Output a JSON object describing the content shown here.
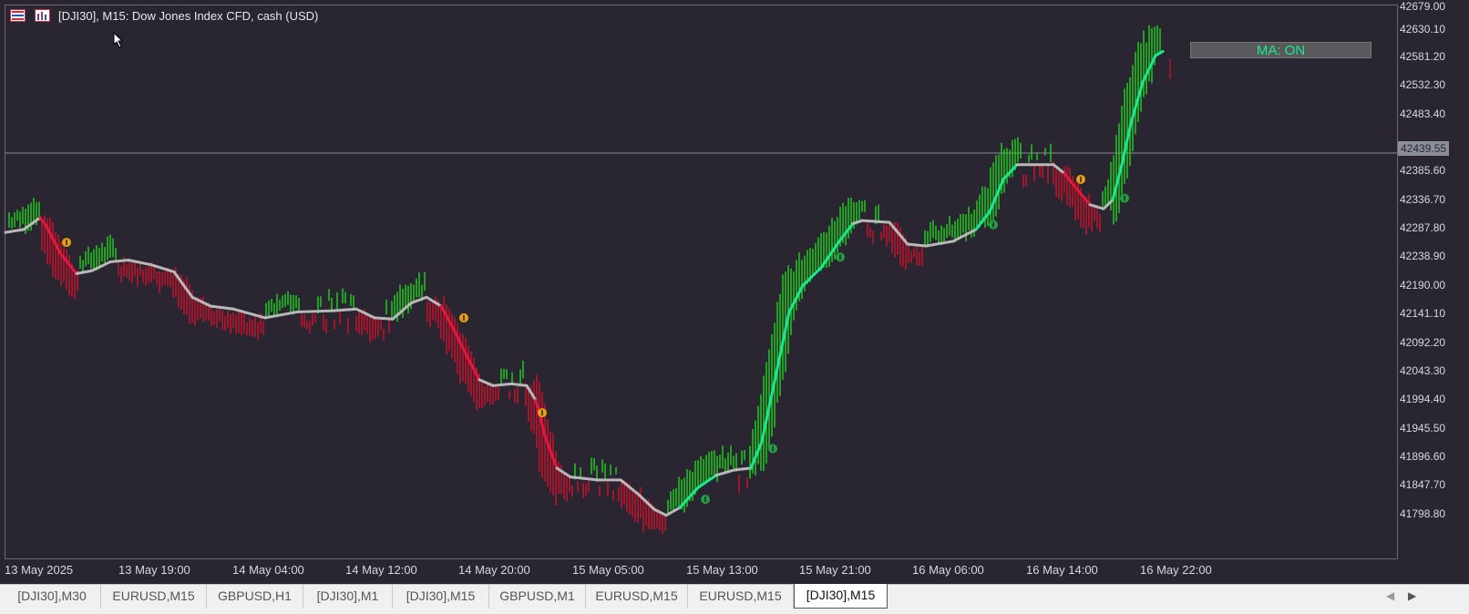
{
  "window": {
    "title": "[DJI30], M15:  Dow Jones Index CFD, cash (USD)",
    "current_price": "42439.55",
    "ma_button_label": "MA: ON"
  },
  "price_axis": {
    "labels": [
      "42679.00",
      "42630.10",
      "42581.20",
      "42532.30",
      "42483.40",
      "42385.60",
      "42336.70",
      "42287.80",
      "42238.90",
      "42190.00",
      "42141.10",
      "42092.20",
      "42043.30",
      "41994.40",
      "41945.50",
      "41896.60",
      "41847.70",
      "41798.80"
    ]
  },
  "time_axis": {
    "labels": [
      "13 May 2025",
      "13 May 19:00",
      "14 May 04:00",
      "14 May 12:00",
      "14 May 20:00",
      "15 May 05:00",
      "15 May 13:00",
      "15 May 21:00",
      "16 May 06:00",
      "16 May 14:00",
      "16 May 22:00"
    ]
  },
  "tabs": [
    {
      "label": "[DJI30],M30",
      "active": false
    },
    {
      "label": "EURUSD,M15",
      "active": false
    },
    {
      "label": "GBPUSD,H1",
      "active": false
    },
    {
      "label": "[DJI30],M1",
      "active": false
    },
    {
      "label": "[DJI30],M15",
      "active": false
    },
    {
      "label": "GBPUSD,M1",
      "active": false
    },
    {
      "label": "EURUSD,M15",
      "active": false
    },
    {
      "label": "EURUSD,M15",
      "active": false
    },
    {
      "label": "[DJI30],M15",
      "active": true
    }
  ],
  "icons": {
    "title_icon_1": "bars-icon",
    "title_icon_2": "chart-window-icon",
    "scroll_left": "chevron-left-icon",
    "scroll_right": "chevron-right-icon",
    "cursor": "mouse-pointer-icon"
  },
  "chart_data": {
    "type": "line",
    "ylim": [
      41775,
      42690
    ],
    "xlim": [
      0,
      1485
    ],
    "colors": {
      "bull_bar": "#1ed41e",
      "bear_bar": "#d4102a",
      "ma_neutral": "#b8b8b8",
      "ma_up": "#19e88e",
      "ma_down": "#e4163c",
      "signal_up": "#20a040",
      "signal_down": "#e8a010",
      "current_price_line": "#8a8f9a"
    },
    "current_price": 42439.55,
    "ma_series": [
      {
        "x": 0,
        "y": 42305,
        "trend": "neutral"
      },
      {
        "x": 20,
        "y": 42310,
        "trend": "neutral"
      },
      {
        "x": 38,
        "y": 42330,
        "trend": "neutral"
      },
      {
        "x": 45,
        "y": 42315,
        "trend": "down"
      },
      {
        "x": 60,
        "y": 42270,
        "trend": "down"
      },
      {
        "x": 78,
        "y": 42235,
        "trend": "down"
      },
      {
        "x": 95,
        "y": 42240,
        "trend": "neutral"
      },
      {
        "x": 115,
        "y": 42255,
        "trend": "neutral"
      },
      {
        "x": 135,
        "y": 42258,
        "trend": "neutral"
      },
      {
        "x": 160,
        "y": 42250,
        "trend": "neutral"
      },
      {
        "x": 185,
        "y": 42238,
        "trend": "neutral"
      },
      {
        "x": 205,
        "y": 42195,
        "trend": "neutral"
      },
      {
        "x": 225,
        "y": 42180,
        "trend": "neutral"
      },
      {
        "x": 250,
        "y": 42175,
        "trend": "neutral"
      },
      {
        "x": 285,
        "y": 42160,
        "trend": "neutral"
      },
      {
        "x": 320,
        "y": 42170,
        "trend": "neutral"
      },
      {
        "x": 360,
        "y": 42172,
        "trend": "neutral"
      },
      {
        "x": 385,
        "y": 42175,
        "trend": "neutral"
      },
      {
        "x": 405,
        "y": 42160,
        "trend": "neutral"
      },
      {
        "x": 425,
        "y": 42158,
        "trend": "neutral"
      },
      {
        "x": 445,
        "y": 42185,
        "trend": "neutral"
      },
      {
        "x": 462,
        "y": 42195,
        "trend": "neutral"
      },
      {
        "x": 478,
        "y": 42180,
        "trend": "neutral"
      },
      {
        "x": 492,
        "y": 42140,
        "trend": "down"
      },
      {
        "x": 508,
        "y": 42090,
        "trend": "down"
      },
      {
        "x": 520,
        "y": 42055,
        "trend": "down"
      },
      {
        "x": 535,
        "y": 42045,
        "trend": "neutral"
      },
      {
        "x": 555,
        "y": 42048,
        "trend": "neutral"
      },
      {
        "x": 572,
        "y": 42045,
        "trend": "neutral"
      },
      {
        "x": 582,
        "y": 42020,
        "trend": "neutral"
      },
      {
        "x": 592,
        "y": 41960,
        "trend": "down"
      },
      {
        "x": 605,
        "y": 41905,
        "trend": "down"
      },
      {
        "x": 620,
        "y": 41890,
        "trend": "neutral"
      },
      {
        "x": 650,
        "y": 41885,
        "trend": "neutral"
      },
      {
        "x": 675,
        "y": 41885,
        "trend": "neutral"
      },
      {
        "x": 695,
        "y": 41860,
        "trend": "neutral"
      },
      {
        "x": 712,
        "y": 41835,
        "trend": "neutral"
      },
      {
        "x": 725,
        "y": 41825,
        "trend": "neutral"
      },
      {
        "x": 740,
        "y": 41838,
        "trend": "neutral"
      },
      {
        "x": 760,
        "y": 41872,
        "trend": "up"
      },
      {
        "x": 780,
        "y": 41893,
        "trend": "up"
      },
      {
        "x": 800,
        "y": 41902,
        "trend": "neutral"
      },
      {
        "x": 818,
        "y": 41905,
        "trend": "neutral"
      },
      {
        "x": 830,
        "y": 41950,
        "trend": "up"
      },
      {
        "x": 845,
        "y": 42060,
        "trend": "up"
      },
      {
        "x": 860,
        "y": 42170,
        "trend": "up"
      },
      {
        "x": 875,
        "y": 42215,
        "trend": "up"
      },
      {
        "x": 895,
        "y": 42245,
        "trend": "up"
      },
      {
        "x": 915,
        "y": 42290,
        "trend": "up"
      },
      {
        "x": 930,
        "y": 42320,
        "trend": "up"
      },
      {
        "x": 940,
        "y": 42325,
        "trend": "neutral"
      },
      {
        "x": 970,
        "y": 42322,
        "trend": "neutral"
      },
      {
        "x": 990,
        "y": 42285,
        "trend": "neutral"
      },
      {
        "x": 1010,
        "y": 42282,
        "trend": "neutral"
      },
      {
        "x": 1040,
        "y": 42290,
        "trend": "neutral"
      },
      {
        "x": 1065,
        "y": 42310,
        "trend": "neutral"
      },
      {
        "x": 1080,
        "y": 42340,
        "trend": "up"
      },
      {
        "x": 1095,
        "y": 42395,
        "trend": "up"
      },
      {
        "x": 1110,
        "y": 42420,
        "trend": "up"
      },
      {
        "x": 1125,
        "y": 42420,
        "trend": "neutral"
      },
      {
        "x": 1150,
        "y": 42420,
        "trend": "neutral"
      },
      {
        "x": 1162,
        "y": 42405,
        "trend": "neutral"
      },
      {
        "x": 1175,
        "y": 42380,
        "trend": "down"
      },
      {
        "x": 1190,
        "y": 42352,
        "trend": "down"
      },
      {
        "x": 1205,
        "y": 42345,
        "trend": "neutral"
      },
      {
        "x": 1215,
        "y": 42360,
        "trend": "neutral"
      },
      {
        "x": 1225,
        "y": 42420,
        "trend": "up"
      },
      {
        "x": 1235,
        "y": 42490,
        "trend": "up"
      },
      {
        "x": 1248,
        "y": 42560,
        "trend": "up"
      },
      {
        "x": 1262,
        "y": 42605,
        "trend": "up"
      },
      {
        "x": 1270,
        "y": 42612,
        "trend": "up"
      }
    ],
    "signals": [
      {
        "x": 67,
        "y": 42288,
        "dir": "down"
      },
      {
        "x": 503,
        "y": 42160,
        "dir": "down"
      },
      {
        "x": 589,
        "y": 41999,
        "dir": "down"
      },
      {
        "x": 768,
        "y": 41852,
        "dir": "up"
      },
      {
        "x": 842,
        "y": 41938,
        "dir": "up"
      },
      {
        "x": 916,
        "y": 42263,
        "dir": "up"
      },
      {
        "x": 1084,
        "y": 42318,
        "dir": "up"
      },
      {
        "x": 1180,
        "y": 42395,
        "dir": "down"
      },
      {
        "x": 1228,
        "y": 42363,
        "dir": "up"
      }
    ],
    "current_candle": {
      "x": 1278,
      "y_high": 42600,
      "y_low": 42565
    }
  }
}
